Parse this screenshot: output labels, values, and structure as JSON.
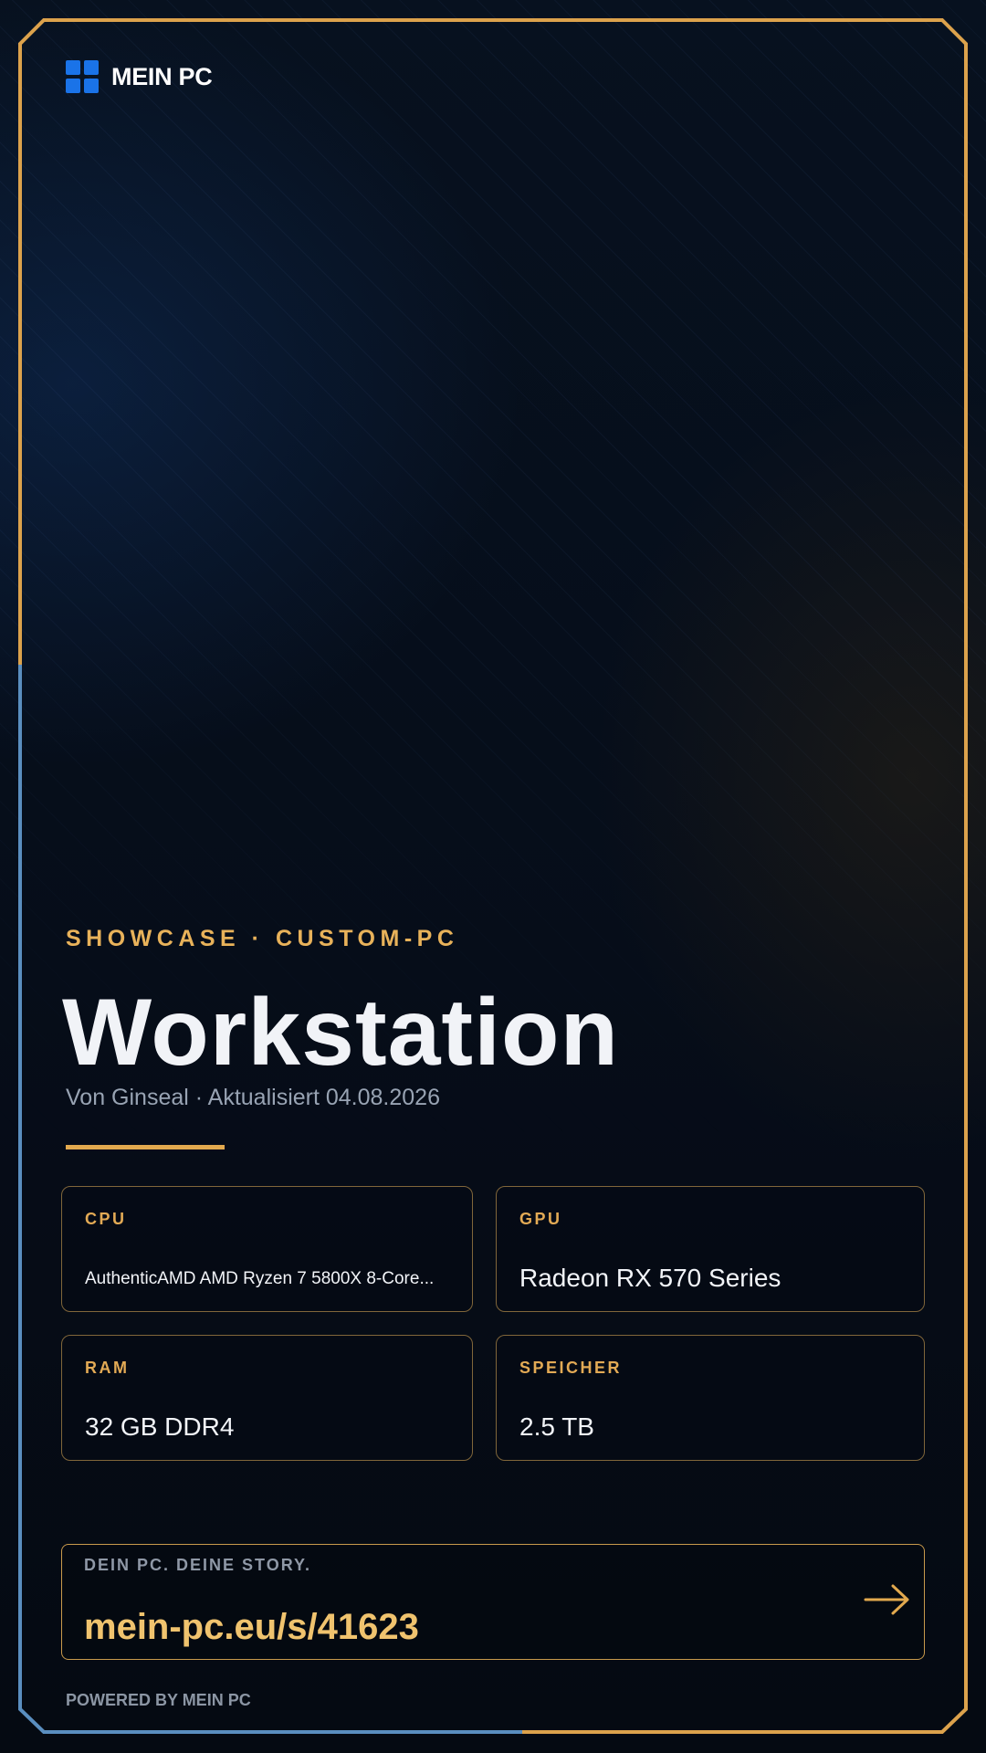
{
  "brand": {
    "name": "MEIN PC",
    "icon": "windows-logo-icon",
    "icon_color": "#1a73e8"
  },
  "hero": {
    "kicker": "SHOWCASE · CUSTOM-PC",
    "title": "Workstation",
    "meta": "Von Ginseal · Aktualisiert 04.08.2026"
  },
  "specs": {
    "cpu": {
      "label": "CPU",
      "value": "AuthenticAMD AMD Ryzen 7 5800X 8-Core..."
    },
    "gpu": {
      "label": "GPU",
      "value": "Radeon RX 570 Series"
    },
    "ram": {
      "label": "RAM",
      "value": "32 GB DDR4"
    },
    "storage": {
      "label": "SPEICHER",
      "value": "2.5 TB"
    }
  },
  "story": {
    "label": "DEIN PC. DEINE STORY.",
    "url": "mein-pc.eu/s/41623",
    "icon": "arrow-right-icon"
  },
  "footer": {
    "powered": "POWERED BY MEIN PC"
  },
  "colors": {
    "accent_gold": "#e2a94e",
    "frame_blue": "#5a8ebf",
    "background": "#050b14"
  }
}
